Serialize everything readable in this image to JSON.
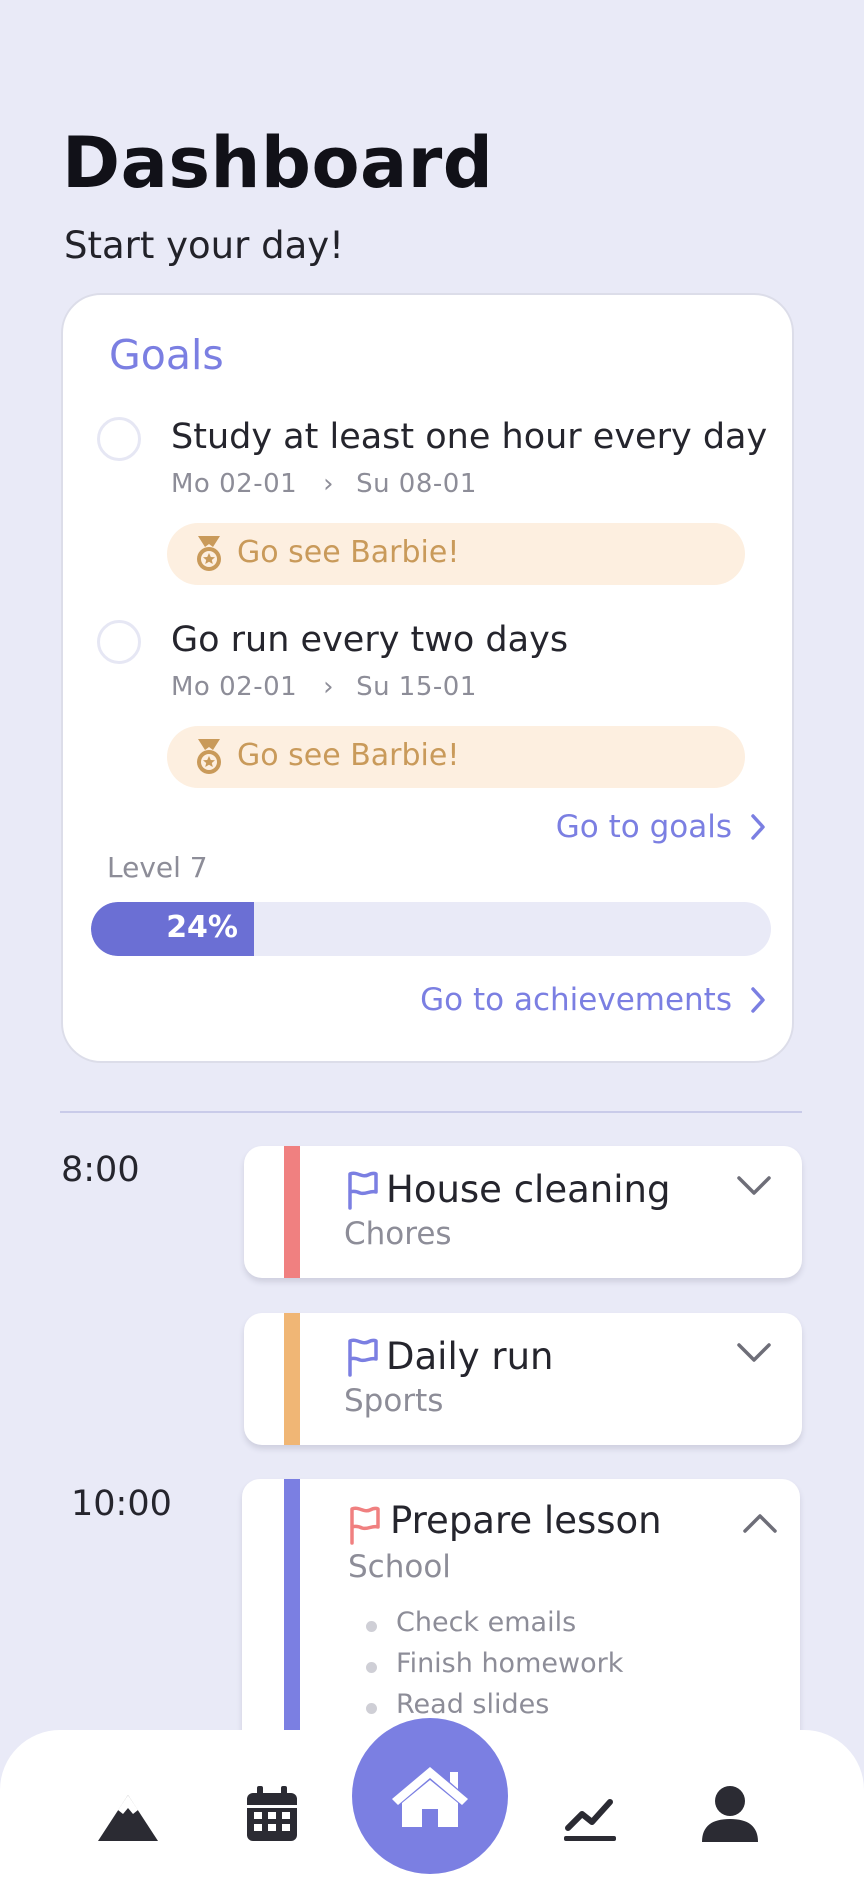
{
  "header": {
    "title": "Dashboard",
    "subtitle": "Start your day!"
  },
  "goals": {
    "title": "Goals",
    "items": [
      {
        "text": "Study at least one hour every day",
        "start": "Mo 02-01",
        "end": "Su 08-01",
        "reward": "Go see Barbie!"
      },
      {
        "text": "Go run every two days",
        "start": "Mo 02-01",
        "end": "Su 15-01",
        "reward": "Go see Barbie!"
      }
    ],
    "goals_link": "Go to goals",
    "level_label": "Level 7",
    "progress": {
      "percent": 24,
      "label": "24%"
    },
    "achievements_link": "Go to achievements"
  },
  "schedule": {
    "times": [
      "8:00",
      "10:00"
    ],
    "tasks": [
      {
        "title": "House cleaning",
        "category": "Chores",
        "color": "#f08080",
        "flag_color": "#7b7fe2"
      },
      {
        "title": "Daily run",
        "category": "Sports",
        "color": "#f0b675",
        "flag_color": "#7b7fe2"
      },
      {
        "title": "Prepare lesson",
        "category": "School",
        "color": "#7b7fe2",
        "flag_color": "#f08080",
        "subtasks": [
          "Check emails",
          "Finish homework",
          "Read slides"
        ]
      }
    ]
  },
  "nav": {
    "items": [
      "mountain-icon",
      "calendar-icon",
      "home-icon",
      "chart-icon",
      "user-icon"
    ],
    "active": "home-icon"
  },
  "colors": {
    "accent": "#7b7fe2",
    "background": "#e9eaf7",
    "reward_bg": "#fdefe0",
    "reward_text": "#c99a5a"
  }
}
